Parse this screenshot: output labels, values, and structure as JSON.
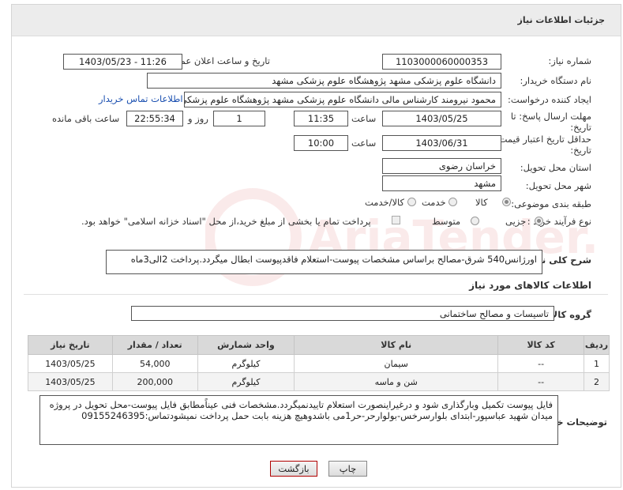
{
  "header": {
    "title": "جزئیات اطلاعات نیاز"
  },
  "fields": {
    "need_number_label": "شماره نیاز:",
    "need_number": "1103000060000353",
    "announce_label": "تاریخ و ساعت اعلان عمومی:",
    "announce_value": "1403/05/23 - 11:26",
    "buyer_org_label": "نام دستگاه خریدار:",
    "buyer_org": "دانشگاه علوم پزشکی مشهد   پژوهشگاه علوم پزشکی مشهد",
    "requester_label": "ایجاد کننده درخواست:",
    "requester": "محمود نیرومند کارشناس مالی دانشگاه علوم پزشکی مشهد   پژوهشگاه علوم پزشکی مشهد",
    "contact_link": "اطلاعات تماس خریدار",
    "deadline_label_1": "مهلت ارسال پاسخ: تا",
    "deadline_label_2": "تاریخ:",
    "deadline_date": "1403/05/25",
    "time_label": "ساعت",
    "deadline_time": "11:35",
    "days_value": "1",
    "days_label": "روز و",
    "remaining_time": "22:55:34",
    "remaining_label": "ساعت باقی مانده",
    "validity_label_1": "حداقل تاریخ اعتبار قیمت: تا",
    "validity_label_2": "تاریخ:",
    "validity_date": "1403/06/31",
    "validity_time_label": "ساعت",
    "validity_time": "10:00",
    "province_label": "استان محل تحویل:",
    "province": "خراسان رضوی",
    "city_label": "شهر محل تحویل:",
    "city": "مشهد",
    "category_label": "طبقه بندی موضوعی:",
    "category_options": [
      "کالا",
      "خدمت",
      "کالا/خدمت"
    ],
    "process_label": "نوع فرآیند خرید :",
    "process_options": [
      "جزیی",
      "متوسط"
    ],
    "payment_note": "پرداخت تمام یا بخشی از مبلغ خرید،از محل \"اسناد خزانه اسلامی\" خواهد بود."
  },
  "description": {
    "label": "شرح کلی نیاز:",
    "text": "اورژانس540 شرق-مصالح براساس مشخصات پیوست-استعلام فاقدپیوست ابطال میگردد.پرداخت 2الی3ماه"
  },
  "goods": {
    "section_title": "اطلاعات کالاهای مورد نیاز",
    "group_label": "گروه کالا:",
    "group_value": "تاسیسات و مصالح ساختمانی",
    "columns": [
      "ردیف",
      "کد کالا",
      "نام کالا",
      "واحد شمارش",
      "تعداد / مقدار",
      "تاریخ نیاز"
    ],
    "rows": [
      [
        "1",
        "--",
        "سیمان",
        "کیلوگرم",
        "54,000",
        "1403/05/25"
      ],
      [
        "2",
        "--",
        "شن و ماسه",
        "کیلوگرم",
        "200,000",
        "1403/05/25"
      ]
    ]
  },
  "buyer_notes": {
    "label": "توضیحات خریدار:",
    "text": "فایل پیوست تکمیل وبارگذاری شود و درغیراینصورت استعلام تاییدنمیگردد.مشخصات فنی عیناًمطابق فایل پیوست-محل تحویل در پروژه میدان شهید عباسپور-ابتدای بلوارسرخس-بولوارحر-حر1می باشدوهیچ هزینه بابت حمل  پرداخت نمیشودتماس:09155246395"
  },
  "buttons": {
    "print": "چاپ",
    "back": "بازگشت"
  },
  "watermark_text": "AriaTender.neT",
  "colors": {
    "accent_link": "#1a4fb0",
    "back_border": "#b00000"
  }
}
